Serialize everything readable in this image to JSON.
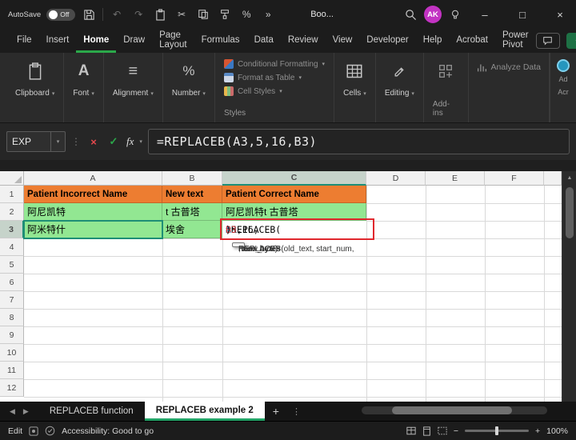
{
  "titlebar": {
    "autosave_label": "AutoSave",
    "autosave_state": "Off",
    "doc_title": "Boo...",
    "avatar_initials": "AK"
  },
  "menubar": {
    "items": [
      "File",
      "Insert",
      "Home",
      "Draw",
      "Page Layout",
      "Formulas",
      "Data",
      "Review",
      "View",
      "Developer",
      "Help",
      "Acrobat",
      "Power Pivot"
    ]
  },
  "ribbon": {
    "groups": [
      {
        "label": "Clipboard"
      },
      {
        "label": "Font"
      },
      {
        "label": "Alignment"
      },
      {
        "label": "Number"
      },
      {
        "label": "Cells"
      },
      {
        "label": "Editing"
      }
    ],
    "styles": {
      "buttons": [
        "Conditional Formatting",
        "Format as Table",
        "Cell Styles"
      ],
      "caption": "Styles"
    },
    "addins_caption": "Add-ins",
    "analyze_data_label": "Analyze Data",
    "partial_right": {
      "line1": "Ad",
      "line2": "Acr"
    }
  },
  "formula_bar": {
    "name_box_value": "EXP",
    "fx_label": "fx",
    "formula": "=REPLACEB(A3,5,16,B3)"
  },
  "grid": {
    "column_headers": [
      "A",
      "B",
      "C",
      "D",
      "E",
      "F"
    ],
    "row_headers": [
      "1",
      "2",
      "3",
      "4",
      "5",
      "6",
      "7",
      "8",
      "9",
      "10",
      "11",
      "12"
    ],
    "cells": {
      "A1": "Patient Incorrect Name",
      "B1": "New text",
      "C1": "Patient Correct Name",
      "A2": "阿尼凯特",
      "B2": "t 古普塔",
      "C2": "阿尼凯特t 古普塔",
      "A3": "阿米特什",
      "B3": "埃舍"
    },
    "c3_formula": {
      "p1": "=REPLACEB(",
      "ref1": "A3",
      "p2": ",5,16,",
      "ref2": "B3",
      "p3": ")"
    },
    "tooltip": {
      "pre": "REPLACEB(old_text, start_num, ",
      "current": "num_bytes",
      "post": ", new_text)"
    }
  },
  "sheet_tabs": {
    "tab1": "REPLACEB function",
    "tab2": "REPLACEB example 2"
  },
  "status_bar": {
    "mode": "Edit",
    "accessibility": "Accessibility: Good to go",
    "zoom": "100%"
  },
  "icons": {
    "chevron_down": "▾",
    "more": "»",
    "undo": "↶",
    "redo": "↷",
    "scissors": "✂",
    "percent": "%",
    "align_lines": "≡",
    "font_letter": "A",
    "check": "✓",
    "cancel": "×",
    "up_arrow": "▲",
    "left_arrow": "◀",
    "right_arrow": "▶",
    "v_ellipsis": "⋮",
    "minimize": "–",
    "maximize": "□",
    "close": "×",
    "plus": "+",
    "minus": "−"
  },
  "colors": {
    "header_fill": "#ED7D31",
    "data_fill": "#92E792",
    "accent_green": "#21A366",
    "selection_border": "#1E8E76",
    "reference_blue": "#2E9BD6",
    "reference_red": "#D13438",
    "edit_border_red": "#E0282E",
    "avatar_bg": "#C333C3"
  }
}
